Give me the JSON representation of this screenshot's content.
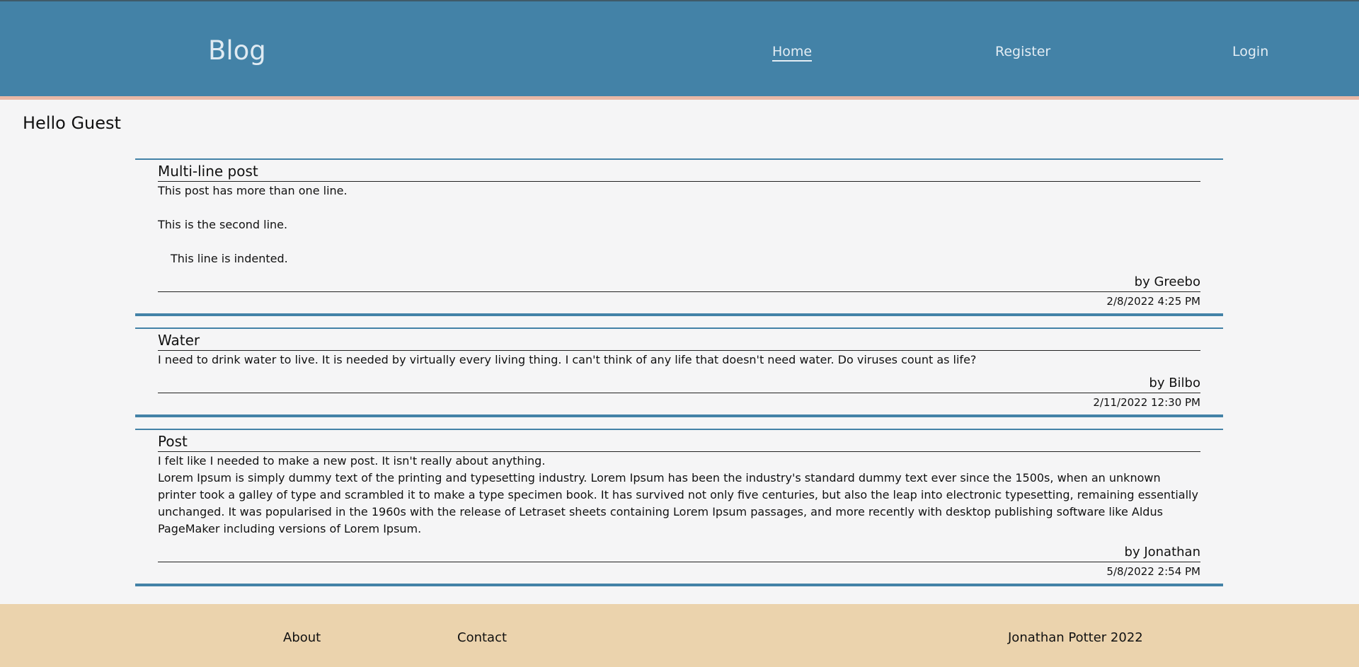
{
  "header": {
    "brand": "Blog",
    "nav": {
      "home": "Home",
      "register": "Register",
      "login": "Login"
    }
  },
  "greeting": "Hello Guest",
  "posts": [
    {
      "title": "Multi-line post",
      "lines": [
        "This post has more than one line.",
        "This is the second line.",
        "This line is indented."
      ],
      "author": "by Greebo",
      "date": "2/8/2022 4:25 PM"
    },
    {
      "title": "Water",
      "lines": [
        "I need to drink water to live.  It is needed by virtually every living thing.  I can't think of any life that doesn't need water.  Do viruses count as life?"
      ],
      "author": "by Bilbo",
      "date": "2/11/2022 12:30 PM"
    },
    {
      "title": "Post",
      "lines": [
        "I felt like I needed to make a new post.  It isn't really about anything.",
        "Lorem Ipsum is simply dummy text of the printing and typesetting industry. Lorem Ipsum has been the industry's standard dummy text ever since the 1500s, when an unknown printer took a galley of type and scrambled it to make a type specimen book. It has survived not only five centuries, but also the leap into electronic typesetting, remaining essentially unchanged. It was popularised in the 1960s with the release of Letraset sheets containing Lorem Ipsum passages, and more recently with desktop publishing software like Aldus PageMaker including versions of Lorem Ipsum."
      ],
      "author": "by Jonathan",
      "date": "5/8/2022 2:54 PM"
    }
  ],
  "footer": {
    "about": "About",
    "contact": "Contact",
    "credit": "Jonathan Potter 2022"
  }
}
